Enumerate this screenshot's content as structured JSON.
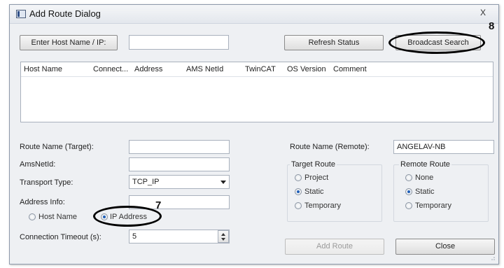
{
  "window": {
    "title": "Add Route Dialog",
    "close_glyph": "X"
  },
  "toolbar": {
    "enter_host_label": "Enter Host Name / IP:",
    "host_value": "",
    "refresh_label": "Refresh Status",
    "broadcast_label": "Broadcast Search"
  },
  "list": {
    "columns": [
      "Host Name",
      "Connect...",
      "Address",
      "AMS NetId",
      "TwinCAT",
      "OS Version",
      "Comment"
    ]
  },
  "form": {
    "route_name_target_label": "Route Name (Target):",
    "route_name_target_value": "",
    "amsnetid_label": "AmsNetId:",
    "amsnetid_value": "",
    "transport_label": "Transport Type:",
    "transport_value": "TCP_IP",
    "address_info_label": "Address Info:",
    "address_info_value": "",
    "host_name_option": "Host Name",
    "ip_address_option": "IP Address",
    "address_mode_selected": "IP Address",
    "timeout_label": "Connection Timeout (s):",
    "timeout_value": "5"
  },
  "remote": {
    "route_name_remote_label": "Route Name (Remote):",
    "route_name_remote_value": "ANGELAV-NB"
  },
  "target_route": {
    "title": "Target Route",
    "options": [
      "Project",
      "Static",
      "Temporary"
    ],
    "selected": "Static"
  },
  "remote_route": {
    "title": "Remote Route",
    "options": [
      "None",
      "Static",
      "Temporary"
    ],
    "selected": "Static"
  },
  "actions": {
    "add_route_label": "Add Route",
    "close_label": "Close"
  },
  "annotations": {
    "callout_7": "7",
    "callout_8": "8"
  }
}
